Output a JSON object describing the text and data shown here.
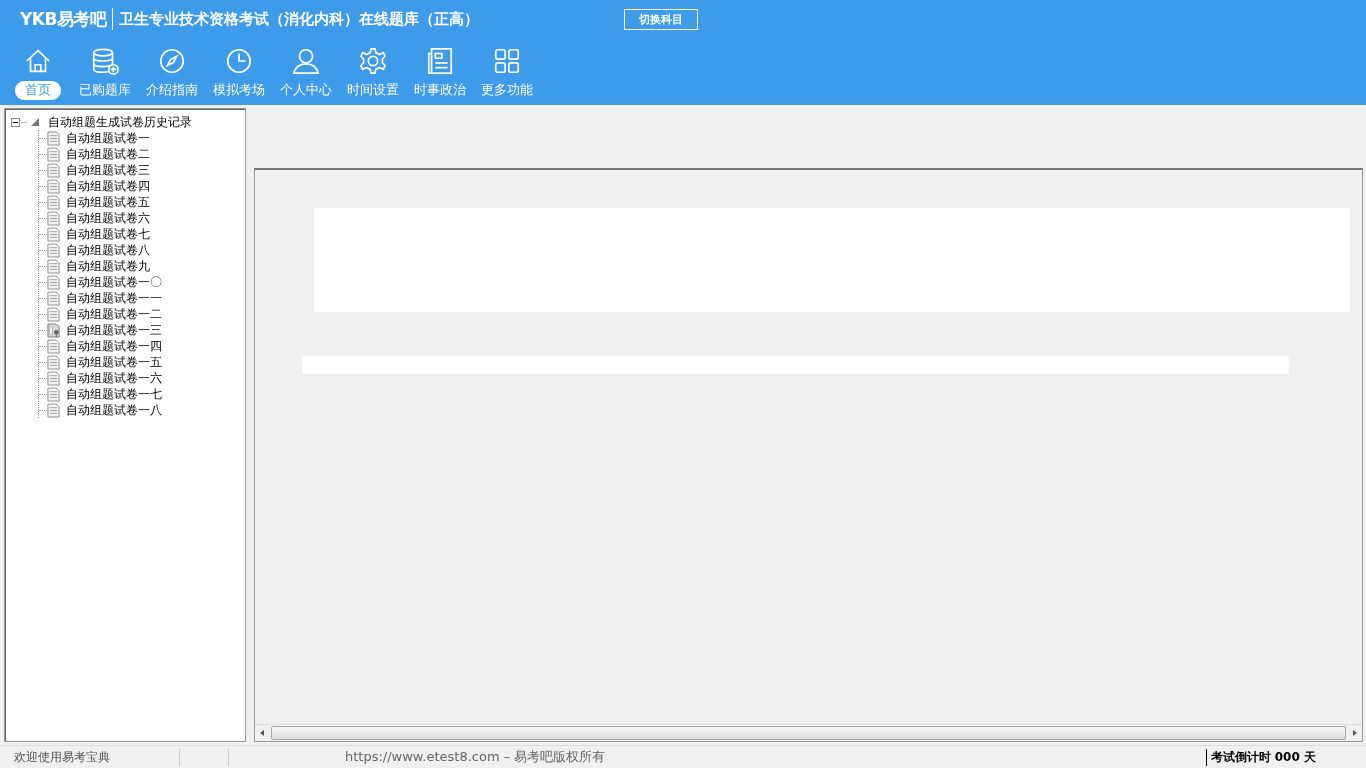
{
  "header": {
    "logo": "YKB易考吧",
    "title": "卫生专业技术资格考试（消化内科）在线题库（正高）",
    "switch_button": "切换科目"
  },
  "toolbar": [
    {
      "label": "首页",
      "selected": true
    },
    {
      "label": "已购题库",
      "selected": false
    },
    {
      "label": "介绍指南",
      "selected": false
    },
    {
      "label": "模拟考场",
      "selected": false
    },
    {
      "label": "个人中心",
      "selected": false
    },
    {
      "label": "时间设置",
      "selected": false
    },
    {
      "label": "时事政治",
      "selected": false
    },
    {
      "label": "更多功能",
      "selected": false
    }
  ],
  "tree": {
    "label": "自动组题生成试卷历史记录",
    "expanded": true,
    "children": [
      {
        "label": "自动组题试卷一",
        "kind": "doc"
      },
      {
        "label": "自动组题试卷二",
        "kind": "doc"
      },
      {
        "label": "自动组题试卷三",
        "kind": "doc"
      },
      {
        "label": "自动组题试卷四",
        "kind": "doc"
      },
      {
        "label": "自动组题试卷五",
        "kind": "doc"
      },
      {
        "label": "自动组题试卷六",
        "kind": "doc"
      },
      {
        "label": "自动组题试卷七",
        "kind": "doc"
      },
      {
        "label": "自动组题试卷八",
        "kind": "doc"
      },
      {
        "label": "自动组题试卷九",
        "kind": "doc"
      },
      {
        "label": "自动组题试卷一〇",
        "kind": "doc"
      },
      {
        "label": "自动组题试卷一一",
        "kind": "doc"
      },
      {
        "label": "自动组题试卷一二",
        "kind": "doc"
      },
      {
        "label": "自动组题试卷一三",
        "kind": "pinned"
      },
      {
        "label": "自动组题试卷一四",
        "kind": "doc"
      },
      {
        "label": "自动组题试卷一五",
        "kind": "doc"
      },
      {
        "label": "自动组题试卷一六",
        "kind": "doc"
      },
      {
        "label": "自动组题试卷一七",
        "kind": "doc"
      },
      {
        "label": "自动组题试卷一八",
        "kind": "doc"
      }
    ]
  },
  "status_bar": {
    "welcome": "欢迎使用易考宝典",
    "copyright": "https://www.etest8.com – 易考吧版权所有",
    "countdown": "考试倒计时 000 天"
  }
}
